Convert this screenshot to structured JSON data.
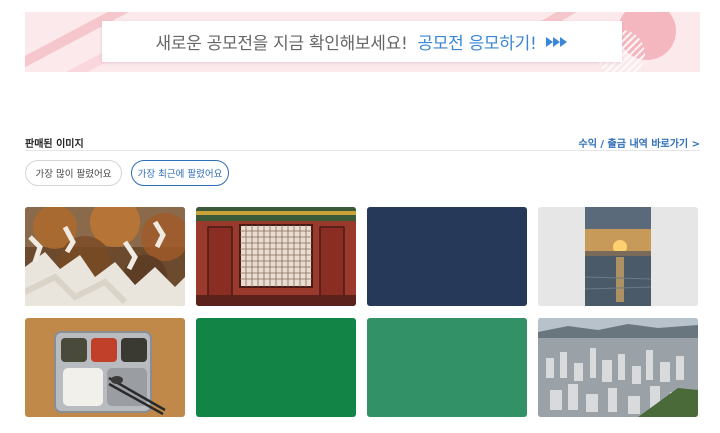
{
  "banner": {
    "message": "새로운 공모전을 지금 확인해보세요!",
    "cta": "공모전 응모하기!",
    "arrow_icon": "fast-forward-icon",
    "colors": {
      "background": "#fbe9ec",
      "cta": "#3b86d6",
      "text": "#666666"
    }
  },
  "section": {
    "title": "판매된 이미지",
    "link": "수익 / 출금 내역 바로가기 >"
  },
  "filters": {
    "options": [
      "가장 많이 팔렸어요",
      "가장 최근에 팔렸어요"
    ],
    "selected": "가장 최근에 팔렸어요"
  },
  "images": [
    {
      "subject": "autumn-tree-with-prayer-papers"
    },
    {
      "subject": "red-traditional-lattice-window"
    },
    {
      "subject": "navy-fabric-texture"
    },
    {
      "subject": "sunset-over-sea"
    },
    {
      "subject": "school-lunch-tray"
    },
    {
      "subject": "green-fabric-texture"
    },
    {
      "subject": "teal-green-fabric-texture"
    },
    {
      "subject": "city-aerial-view"
    }
  ]
}
